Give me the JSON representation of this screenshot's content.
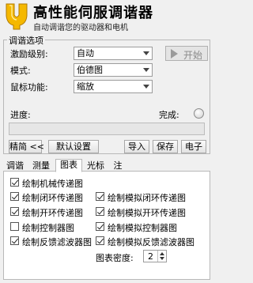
{
  "app": {
    "title": "高性能伺服调谐器",
    "subtitle": "自动调谐您的驱动器和电机",
    "logo_icon": "tuning-fork-logo",
    "logo_color": "#f5b800"
  },
  "tuning_group": {
    "title": "调谐选项",
    "excitation_label": "激励级别:",
    "excitation_value": "自动",
    "mode_label": "模式:",
    "mode_value": "伯德图",
    "mouse_label": "鼠标功能:",
    "mouse_value": "缩放",
    "start_label": "开始",
    "progress_label": "进度:",
    "done_label": "完成:",
    "progress_fraction": 0
  },
  "buttons": {
    "simple": "精简 <<",
    "defaults": "默认设置",
    "import": "导入",
    "save": "保存",
    "electronic": "电子"
  },
  "tabs": [
    {
      "label": "调谐",
      "active": false
    },
    {
      "label": "测量",
      "active": false
    },
    {
      "label": "图表",
      "active": true
    },
    {
      "label": "光标",
      "active": false
    },
    {
      "label": "注",
      "active": false
    }
  ],
  "chart_options": {
    "left": [
      {
        "label": "绘制机械传递图",
        "checked": true
      },
      {
        "label": "绘制闭环传递图",
        "checked": true
      },
      {
        "label": "绘制开环传递图",
        "checked": true
      },
      {
        "label": "绘制控制器图",
        "checked": false
      },
      {
        "label": "绘制反馈滤波器图",
        "checked": true
      }
    ],
    "right": [
      {
        "label": "绘制模拟闭环传递图",
        "checked": true
      },
      {
        "label": "绘制模拟开环传递图",
        "checked": true
      },
      {
        "label": "绘制模拟控制器图",
        "checked": true
      },
      {
        "label": "绘制模拟反馈滤波器图",
        "checked": true
      }
    ],
    "density_label": "图表密度:",
    "density_value": "2"
  }
}
